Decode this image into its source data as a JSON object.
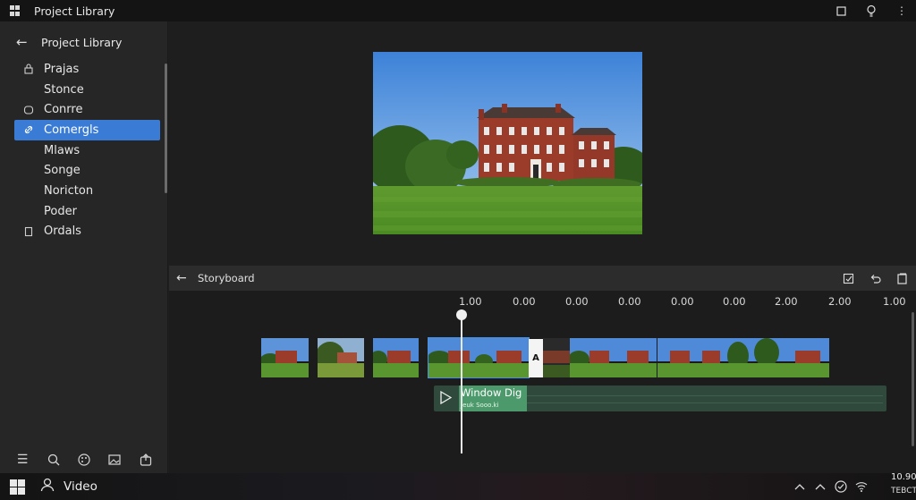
{
  "window": {
    "title": "Project Library",
    "icons": [
      "windows-logo-icon",
      "maximize-icon",
      "lightbulb-icon",
      "more-icon"
    ]
  },
  "sidebar": {
    "back_label": "Project Library",
    "items": [
      {
        "label": "Prajas",
        "icon": "lock-icon",
        "selected": false
      },
      {
        "label": "Stonce",
        "icon": "",
        "selected": false
      },
      {
        "label": "Conrre",
        "icon": "shape-icon",
        "selected": false
      },
      {
        "label": "Comergls",
        "icon": "link-icon",
        "selected": true
      },
      {
        "label": "Mlaws",
        "icon": "",
        "selected": false
      },
      {
        "label": "Songe",
        "icon": "",
        "selected": false
      },
      {
        "label": "Noricton",
        "icon": "",
        "selected": false
      },
      {
        "label": "Poder",
        "icon": "",
        "selected": false
      },
      {
        "label": "Ordals",
        "icon": "document-icon",
        "selected": false
      }
    ],
    "tools": [
      "menu-icon",
      "search-icon",
      "palette-icon",
      "image-icon",
      "export-icon"
    ]
  },
  "storyboard": {
    "label": "Storyboard",
    "tools": [
      "crop-icon",
      "undo-icon",
      "copy-icon"
    ]
  },
  "timeline": {
    "ruler": [
      "1.00",
      "0.00",
      "0.00",
      "0.00",
      "0.00",
      "0.00",
      "2.00",
      "2.00",
      "1.00"
    ],
    "transition_label": "A",
    "audio": {
      "title": "Window Dig",
      "subtitle": "Jeuk Sooo.ki"
    }
  },
  "taskbar": {
    "app_label": "Video",
    "time": "10.90",
    "date": "TEBCTJOM",
    "tray_icons": [
      "chevron-up-icon",
      "chevron-up-icon",
      "clock-icon",
      "wifi-icon"
    ]
  },
  "colors": {
    "accent": "#3a7bd5",
    "audio_track": "#2f4a3c",
    "audio_label": "#4c9a6c"
  }
}
